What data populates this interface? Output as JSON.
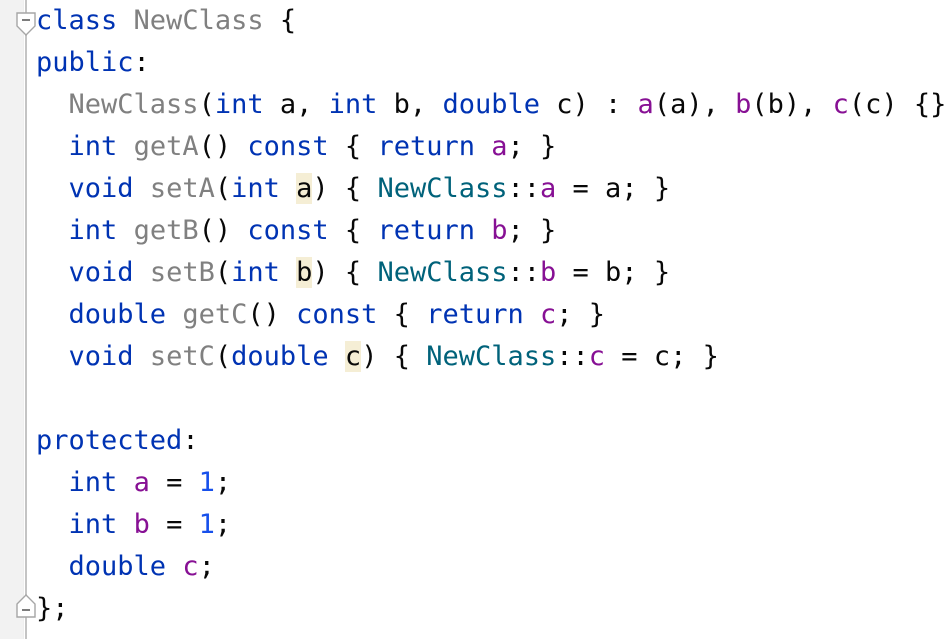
{
  "editor": {
    "language": "cpp",
    "background": "#ffffff",
    "gutter_background": "#f2f2f2",
    "fold_line_color": "#c4c4c4",
    "highlight_color": "#f5eed5",
    "font_size_px": 27,
    "line_height_px": 42,
    "colors": {
      "keyword": "#0033b3",
      "declaration_name": "#808080",
      "member_field": "#871094",
      "qualified_class": "#00627a",
      "number": "#1750eb",
      "plain": "#080808"
    }
  },
  "gutter": {
    "fold_markers": [
      {
        "name": "fold-region-start",
        "glyph": "minus",
        "direction": "down",
        "line": 1,
        "expanded": true
      },
      {
        "name": "fold-region-end",
        "glyph": "minus",
        "direction": "up",
        "line": 15,
        "expanded": true
      }
    ]
  },
  "code": {
    "lines": [
      {
        "n": 1,
        "tokens": [
          {
            "t": "class",
            "c": "kw"
          },
          {
            "t": " ",
            "c": "pln"
          },
          {
            "t": "NewClass",
            "c": "cls"
          },
          {
            "t": " ",
            "c": "pln"
          },
          {
            "t": "{",
            "c": "pln"
          }
        ]
      },
      {
        "n": 2,
        "tokens": [
          {
            "t": "public",
            "c": "kw"
          },
          {
            "t": ":",
            "c": "pln"
          }
        ]
      },
      {
        "n": 3,
        "tokens": [
          {
            "t": "  ",
            "c": "pln"
          },
          {
            "t": "NewClass",
            "c": "cls"
          },
          {
            "t": "(",
            "c": "pln"
          },
          {
            "t": "int",
            "c": "kw"
          },
          {
            "t": " a, ",
            "c": "pln"
          },
          {
            "t": "int",
            "c": "kw"
          },
          {
            "t": " b, ",
            "c": "pln"
          },
          {
            "t": "double",
            "c": "kw"
          },
          {
            "t": " c) : ",
            "c": "pln"
          },
          {
            "t": "a",
            "c": "mem"
          },
          {
            "t": "(a), ",
            "c": "pln"
          },
          {
            "t": "b",
            "c": "mem"
          },
          {
            "t": "(b), ",
            "c": "pln"
          },
          {
            "t": "c",
            "c": "mem"
          },
          {
            "t": "(c) {}",
            "c": "pln"
          }
        ]
      },
      {
        "n": 4,
        "tokens": [
          {
            "t": "  ",
            "c": "pln"
          },
          {
            "t": "int",
            "c": "kw"
          },
          {
            "t": " ",
            "c": "pln"
          },
          {
            "t": "getA",
            "c": "cls"
          },
          {
            "t": "() ",
            "c": "pln"
          },
          {
            "t": "const",
            "c": "kw"
          },
          {
            "t": " { ",
            "c": "pln"
          },
          {
            "t": "return",
            "c": "kw"
          },
          {
            "t": " ",
            "c": "pln"
          },
          {
            "t": "a",
            "c": "mem"
          },
          {
            "t": "; }",
            "c": "pln"
          }
        ]
      },
      {
        "n": 5,
        "tokens": [
          {
            "t": "  ",
            "c": "pln"
          },
          {
            "t": "void",
            "c": "kw"
          },
          {
            "t": " ",
            "c": "pln"
          },
          {
            "t": "setA",
            "c": "cls"
          },
          {
            "t": "(",
            "c": "pln"
          },
          {
            "t": "int",
            "c": "kw"
          },
          {
            "t": " ",
            "c": "pln"
          },
          {
            "t": "a",
            "c": "pln",
            "hl": true
          },
          {
            "t": ") { ",
            "c": "pln"
          },
          {
            "t": "NewClass",
            "c": "qual"
          },
          {
            "t": "::",
            "c": "pln"
          },
          {
            "t": "a",
            "c": "mem"
          },
          {
            "t": " = a; }",
            "c": "pln"
          }
        ]
      },
      {
        "n": 6,
        "tokens": [
          {
            "t": "  ",
            "c": "pln"
          },
          {
            "t": "int",
            "c": "kw"
          },
          {
            "t": " ",
            "c": "pln"
          },
          {
            "t": "getB",
            "c": "cls"
          },
          {
            "t": "() ",
            "c": "pln"
          },
          {
            "t": "const",
            "c": "kw"
          },
          {
            "t": " { ",
            "c": "pln"
          },
          {
            "t": "return",
            "c": "kw"
          },
          {
            "t": " ",
            "c": "pln"
          },
          {
            "t": "b",
            "c": "mem"
          },
          {
            "t": "; }",
            "c": "pln"
          }
        ]
      },
      {
        "n": 7,
        "tokens": [
          {
            "t": "  ",
            "c": "pln"
          },
          {
            "t": "void",
            "c": "kw"
          },
          {
            "t": " ",
            "c": "pln"
          },
          {
            "t": "setB",
            "c": "cls"
          },
          {
            "t": "(",
            "c": "pln"
          },
          {
            "t": "int",
            "c": "kw"
          },
          {
            "t": " ",
            "c": "pln"
          },
          {
            "t": "b",
            "c": "pln",
            "hl": true
          },
          {
            "t": ") { ",
            "c": "pln"
          },
          {
            "t": "NewClass",
            "c": "qual"
          },
          {
            "t": "::",
            "c": "pln"
          },
          {
            "t": "b",
            "c": "mem"
          },
          {
            "t": " = b; }",
            "c": "pln"
          }
        ]
      },
      {
        "n": 8,
        "tokens": [
          {
            "t": "  ",
            "c": "pln"
          },
          {
            "t": "double",
            "c": "kw"
          },
          {
            "t": " ",
            "c": "pln"
          },
          {
            "t": "getC",
            "c": "cls"
          },
          {
            "t": "() ",
            "c": "pln"
          },
          {
            "t": "const",
            "c": "kw"
          },
          {
            "t": " { ",
            "c": "pln"
          },
          {
            "t": "return",
            "c": "kw"
          },
          {
            "t": " ",
            "c": "pln"
          },
          {
            "t": "c",
            "c": "mem"
          },
          {
            "t": "; }",
            "c": "pln"
          }
        ]
      },
      {
        "n": 9,
        "tokens": [
          {
            "t": "  ",
            "c": "pln"
          },
          {
            "t": "void",
            "c": "kw"
          },
          {
            "t": " ",
            "c": "pln"
          },
          {
            "t": "setC",
            "c": "cls"
          },
          {
            "t": "(",
            "c": "pln"
          },
          {
            "t": "double",
            "c": "kw"
          },
          {
            "t": " ",
            "c": "pln"
          },
          {
            "t": "c",
            "c": "pln",
            "hl": true
          },
          {
            "t": ") { ",
            "c": "pln"
          },
          {
            "t": "NewClass",
            "c": "qual"
          },
          {
            "t": "::",
            "c": "pln"
          },
          {
            "t": "c",
            "c": "mem"
          },
          {
            "t": " = c; }",
            "c": "pln"
          }
        ]
      },
      {
        "n": 10,
        "tokens": []
      },
      {
        "n": 11,
        "tokens": [
          {
            "t": "protected",
            "c": "kw"
          },
          {
            "t": ":",
            "c": "pln"
          }
        ]
      },
      {
        "n": 12,
        "tokens": [
          {
            "t": "  ",
            "c": "pln"
          },
          {
            "t": "int",
            "c": "kw"
          },
          {
            "t": " ",
            "c": "pln"
          },
          {
            "t": "a",
            "c": "mem"
          },
          {
            "t": " = ",
            "c": "pln"
          },
          {
            "t": "1",
            "c": "num"
          },
          {
            "t": ";",
            "c": "pln"
          }
        ]
      },
      {
        "n": 13,
        "tokens": [
          {
            "t": "  ",
            "c": "pln"
          },
          {
            "t": "int",
            "c": "kw"
          },
          {
            "t": " ",
            "c": "pln"
          },
          {
            "t": "b",
            "c": "mem"
          },
          {
            "t": " = ",
            "c": "pln"
          },
          {
            "t": "1",
            "c": "num"
          },
          {
            "t": ";",
            "c": "pln"
          }
        ]
      },
      {
        "n": 14,
        "tokens": [
          {
            "t": "  ",
            "c": "pln"
          },
          {
            "t": "double",
            "c": "kw"
          },
          {
            "t": " ",
            "c": "pln"
          },
          {
            "t": "c",
            "c": "mem"
          },
          {
            "t": ";",
            "c": "pln"
          }
        ]
      },
      {
        "n": 15,
        "tokens": [
          {
            "t": "};",
            "c": "pln"
          }
        ]
      }
    ]
  }
}
